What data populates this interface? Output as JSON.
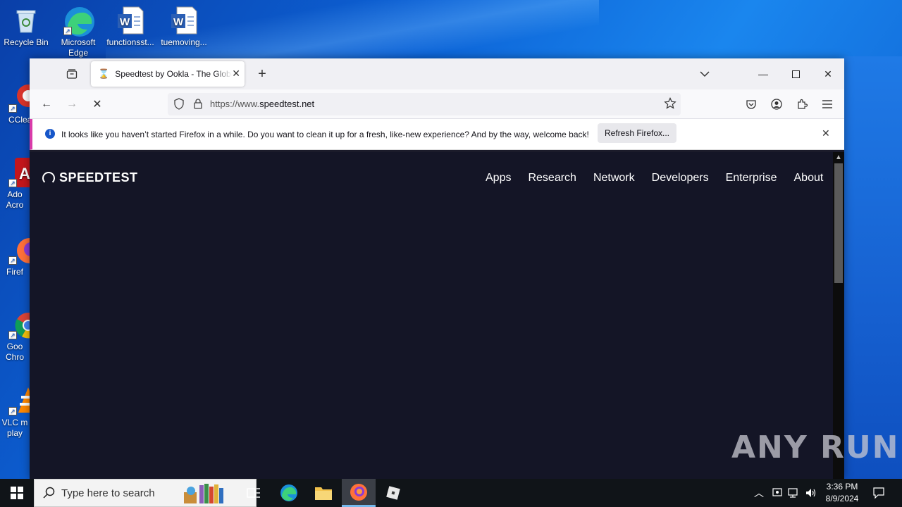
{
  "desktop": {
    "icons": [
      {
        "label": "Recycle Bin"
      },
      {
        "label": "Microsoft Edge"
      },
      {
        "label": "functionsst..."
      },
      {
        "label": "tuemoving..."
      },
      {
        "label": "CClea"
      },
      {
        "label": "Ado Acro"
      },
      {
        "label": "Firef"
      },
      {
        "label": "Goo Chro"
      },
      {
        "label": "VLC m play"
      }
    ]
  },
  "browser": {
    "tab": {
      "title": "Speedtest by Ookla - The Global Broadband Speed Test"
    },
    "url": {
      "prefix": "https://www.",
      "domain": "speedtest.net"
    },
    "notification": {
      "message": "It looks like you haven’t started Firefox in a while. Do you want to clean it up for a fresh, like-new experience? And by the way, welcome back!",
      "button_label": "Refresh Firefox..."
    }
  },
  "site": {
    "logo": "SPEEDTEST",
    "nav": [
      "Apps",
      "Research",
      "Network",
      "Developers",
      "Enterprise",
      "About"
    ]
  },
  "taskbar": {
    "search_placeholder": "Type here to search",
    "time": "3:36 PM",
    "date": "8/9/2024"
  },
  "watermark": "ANY RUN"
}
